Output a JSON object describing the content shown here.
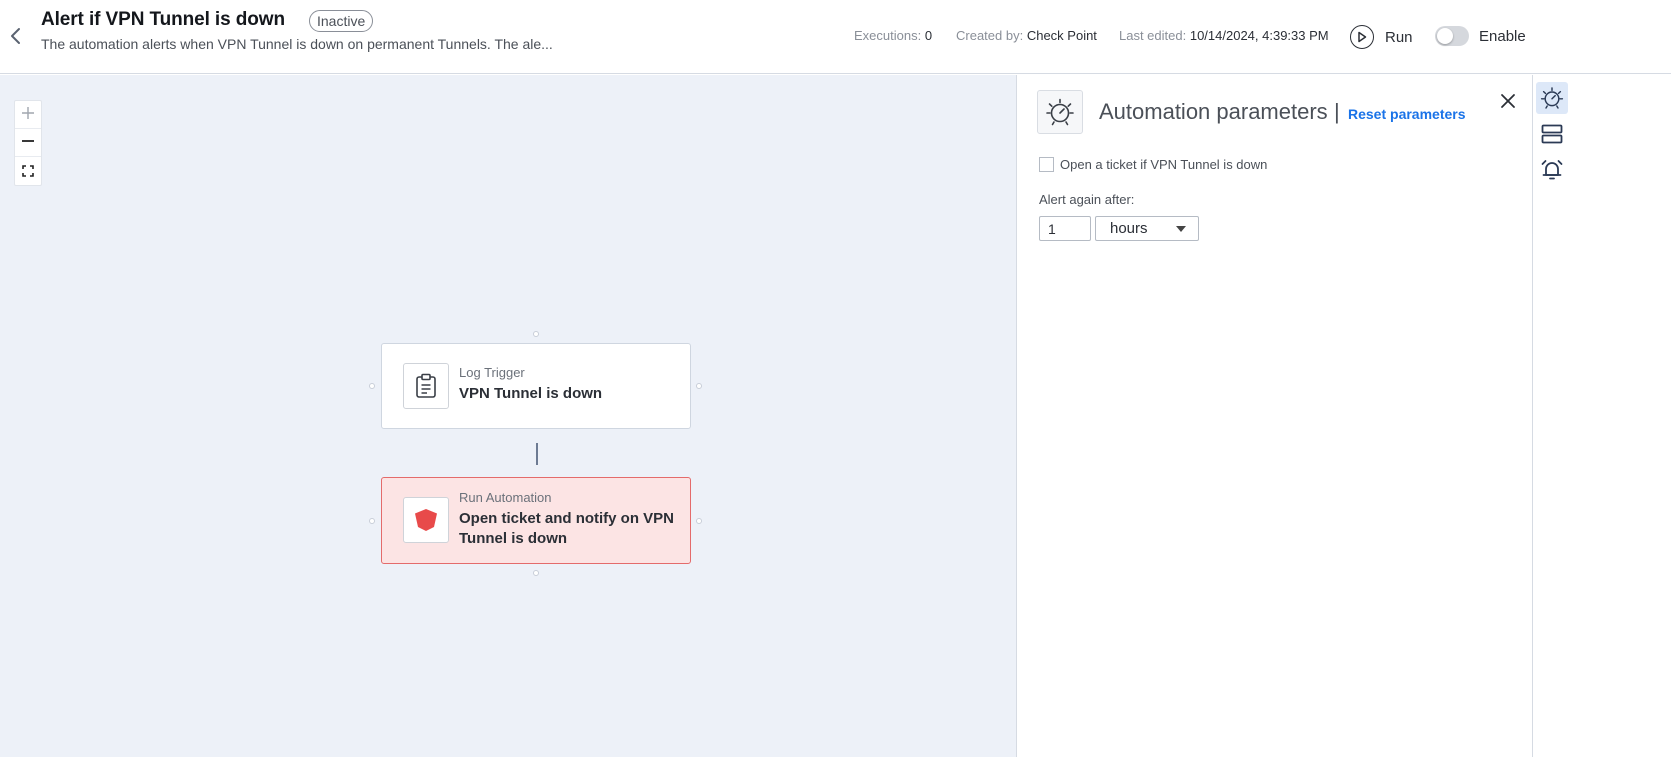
{
  "header": {
    "title": "Alert if VPN Tunnel is down",
    "status": "Inactive",
    "description": "The automation alerts when VPN Tunnel is down on permanent Tunnels. The ale...",
    "executions_label": "Executions:",
    "executions_value": "0",
    "created_label": "Created by:",
    "created_value": "Check Point",
    "edited_label": "Last edited:",
    "edited_value": "10/14/2024, 4:39:33 PM",
    "run_label": "Run",
    "enable_label": "Enable",
    "enabled": false
  },
  "canvas": {
    "zoom_in": "+",
    "zoom_out": "—",
    "nodes": [
      {
        "type": "Log Trigger",
        "name": "VPN Tunnel is down",
        "icon": "clipboard-icon"
      },
      {
        "type": "Run Automation",
        "name": "Open ticket and notify on VPN Tunnel is down",
        "icon": "red-shield-icon",
        "color": "#e84a4a"
      }
    ]
  },
  "panel": {
    "title": "Automation parameters",
    "separator": "|",
    "reset_label": "Reset parameters",
    "checkbox_label": "Open a ticket if VPN Tunnel is down",
    "checkbox_checked": false,
    "alert_label": "Alert again after:",
    "alert_value": "1",
    "alert_unit": "hours"
  },
  "rail": [
    "automation-icon",
    "layout-icon",
    "alarm-icon"
  ],
  "colors": {
    "accent": "#1a73e8",
    "canvas_bg": "#edf1f8",
    "action_bg": "#fce4e4",
    "action_border": "#e46b6b"
  }
}
